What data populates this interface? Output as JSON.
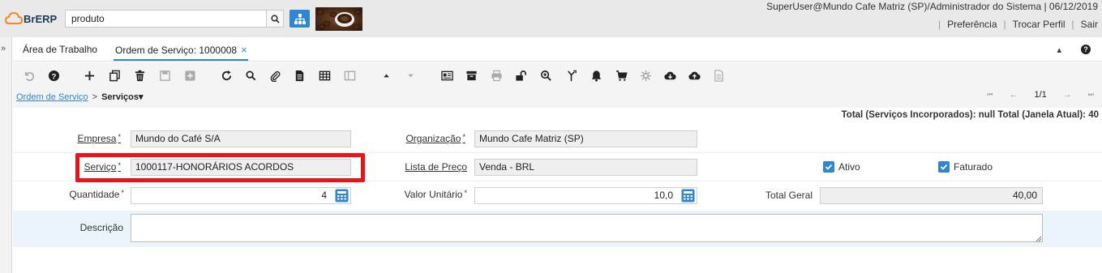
{
  "header": {
    "logo_text": "BrERP",
    "search_value": "produto",
    "user_info": "SuperUser@Mundo Cafe Matriz (SP)/Administrador do Sistema | 06/12/2019",
    "links": [
      "Preferência",
      "Trocar Perfil",
      "Sair"
    ]
  },
  "tabs": [
    {
      "label": "Área de Trabalho",
      "active": false
    },
    {
      "label": "Ordem de Serviço: 1000008",
      "active": true,
      "closable": true,
      "close_glyph": "×"
    }
  ],
  "tabbar_right": {
    "minimize_glyph": "▴",
    "help_glyph": "?"
  },
  "toolbar": {
    "icons": [
      "undo-icon",
      "help-icon",
      "new-icon",
      "copy-icon",
      "delete-icon",
      "save-icon",
      "save-new-icon",
      "refresh-icon",
      "find-icon",
      "attachment-icon",
      "report-icon",
      "grid-toggle-icon",
      "detail-icon",
      "previous-tab-icon",
      "next-tab-icon",
      "form-icon",
      "archive-icon",
      "print-icon",
      "lock-icon",
      "zoom-icon",
      "workflow-icon",
      "notification-icon",
      "cart-icon",
      "process-icon",
      "download-icon",
      "upload-icon",
      "document-icon"
    ]
  },
  "breadcrumb": {
    "link": "Ordem de Serviço",
    "separator": ">",
    "current": "Serviços",
    "current_suffix": "▾"
  },
  "record_nav": {
    "first_glyph": "⏮",
    "prev_glyph": "←",
    "position": "1/1",
    "next_glyph": "→",
    "last_glyph": "⏭"
  },
  "totals": "Total (Serviços Incorporados): null Total (Janela Atual): 40",
  "form": {
    "empresa": {
      "label": "Empresa",
      "required": "*",
      "value": "Mundo do Café S/A"
    },
    "organizacao": {
      "label": "Organização",
      "required": "*",
      "value": "Mundo Cafe Matriz (SP)"
    },
    "servico": {
      "label": "Serviço",
      "required": "*",
      "value": "1000117-HONORÁRIOS ACORDOS"
    },
    "lista_preco": {
      "label": "Lista de Preço",
      "value": "Venda - BRL"
    },
    "ativo": {
      "label": "Ativo",
      "checked": true
    },
    "faturado": {
      "label": "Faturado",
      "checked": true
    },
    "quantidade": {
      "label": "Quantidade",
      "required": "*",
      "value": "4"
    },
    "valor_unitario": {
      "label": "Valor Unitário",
      "required": "*",
      "value": "10,0"
    },
    "total_geral": {
      "label": "Total Geral",
      "value": "40,00"
    },
    "descricao": {
      "label": "Descrição",
      "value": ""
    }
  },
  "colors": {
    "accent": "#2f86d4",
    "highlight": "#e8141a",
    "header_bg": "#e9e9e9",
    "row_highlight_bg": "#e9f4fb"
  }
}
